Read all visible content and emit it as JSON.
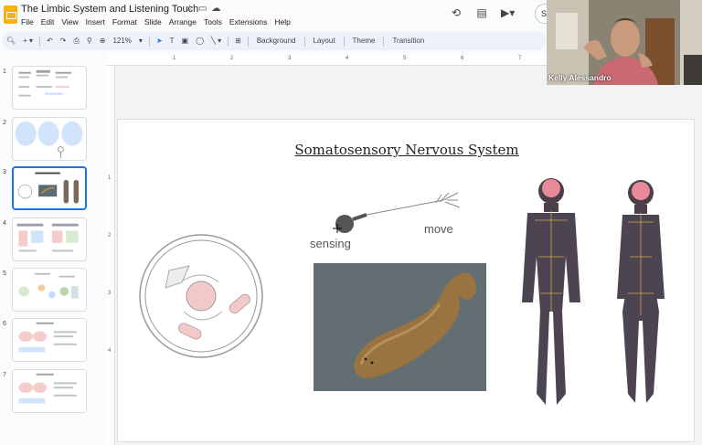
{
  "document": {
    "title": "The Limbic System and Listening Touch"
  },
  "menu": [
    "File",
    "Edit",
    "View",
    "Insert",
    "Format",
    "Slide",
    "Arrange",
    "Tools",
    "Extensions",
    "Help"
  ],
  "header": {
    "share_label": "S"
  },
  "toolbar": {
    "zoom": "121%",
    "background": "Background",
    "layout": "Layout",
    "theme": "Theme",
    "transition": "Transition"
  },
  "ruler": {
    "h": [
      "1",
      "2",
      "3",
      "4",
      "5",
      "6",
      "7"
    ],
    "v": [
      "1",
      "2",
      "3",
      "4"
    ]
  },
  "filmstrip": {
    "slides": [
      "1",
      "2",
      "3",
      "4",
      "5",
      "6",
      "7"
    ],
    "selected": 3
  },
  "slide": {
    "title": "Somatosensory Nervous System",
    "label_sensing": "sensing",
    "label_move": "move"
  },
  "video": {
    "participant_name": "Kelly Alessandro"
  },
  "colors": {
    "accent": "#1a73e8",
    "toolbar_bg": "#edf2fa",
    "logo": "#f4b400",
    "cell_pink": "#f2c9c9"
  }
}
